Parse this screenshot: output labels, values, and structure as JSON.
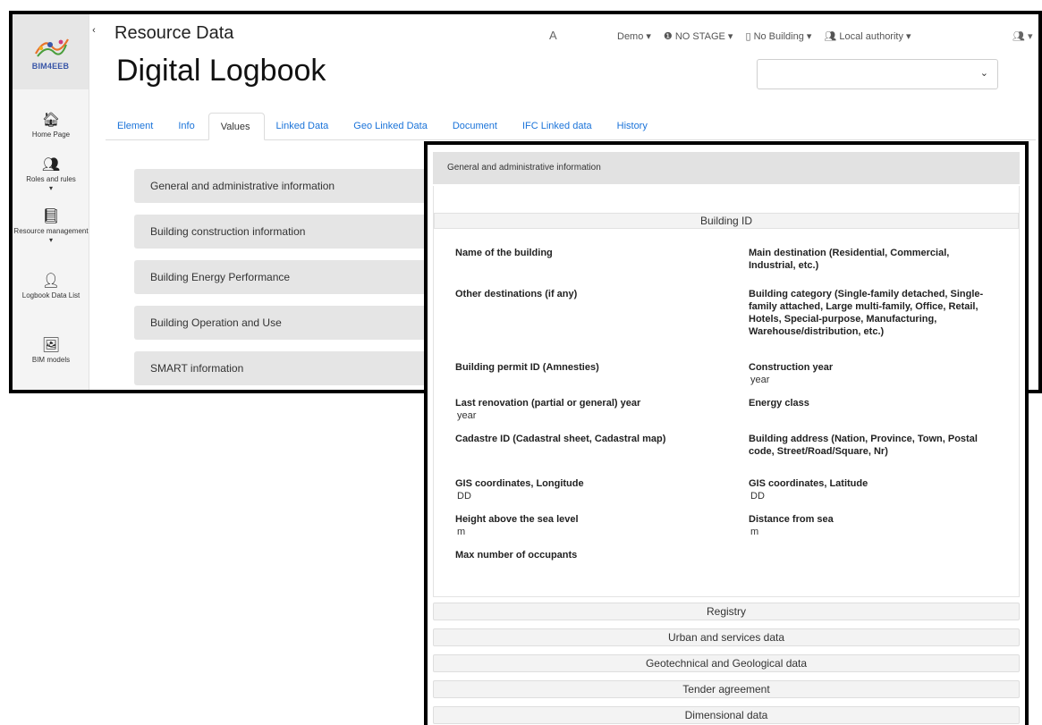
{
  "sidebar": {
    "logo_text": "BIM4EEB",
    "collapse_glyph": "‹",
    "items": [
      {
        "icon": "home-icon",
        "glyph": "🏠︎",
        "label": "Home Page"
      },
      {
        "icon": "users-icon",
        "glyph": "👥︎",
        "label": "Roles and rules",
        "caret": "▾"
      },
      {
        "icon": "book-icon",
        "glyph": "📘︎",
        "label": "Resource management",
        "caret": "▾"
      },
      {
        "icon": "logbook-icon",
        "glyph": "👤︎",
        "label": "Logbook Data List"
      },
      {
        "icon": "image-icon",
        "glyph": "🖼︎",
        "label": "BIM models"
      }
    ]
  },
  "header": {
    "subtitle": "Resource Data",
    "title": "Digital Logbook",
    "translate_glyph": "A",
    "project": "Demo ▾",
    "stage": "❶ NO STAGE ▾",
    "building": "▯ No Building ▾",
    "role": "👥︎ Local authority ▾",
    "user": "👥︎ ▾",
    "select_value": "",
    "select_arrow": "⌄"
  },
  "tabs": [
    {
      "label": "Element",
      "active": false
    },
    {
      "label": "Info",
      "active": false
    },
    {
      "label": "Values",
      "active": true
    },
    {
      "label": "Linked Data",
      "active": false
    },
    {
      "label": "Geo Linked Data",
      "active": false
    },
    {
      "label": "Document",
      "active": false
    },
    {
      "label": "IFC Linked data",
      "active": false
    },
    {
      "label": "History",
      "active": false
    }
  ],
  "accordion": [
    "General and administrative information",
    "Building construction information",
    "Building Energy Performance",
    "Building Operation and Use",
    "SMART information"
  ],
  "overlay": {
    "header": "General and administrative information",
    "section_title": "Building ID",
    "fields": [
      {
        "label": "Name of the building",
        "unit": ""
      },
      {
        "label": "Main destination (Residential, Commercial, Industrial, etc.)",
        "unit": ""
      },
      {
        "label": "Other destinations (if any)",
        "unit": ""
      },
      {
        "label": "Building category (Single-family detached, Single-family attached, Large multi-family, Office, Retail, Hotels, Special-purpose, Manufacturing, Warehouse/distribution, etc.)",
        "unit": ""
      },
      {
        "label": "Building permit ID (Amnesties)",
        "unit": ""
      },
      {
        "label": "Construction year",
        "unit": "year"
      },
      {
        "label": "Last renovation (partial or general) year",
        "unit": "year"
      },
      {
        "label": "Energy class",
        "unit": ""
      },
      {
        "label": "Cadastre ID (Cadastral sheet, Cadastral map)",
        "unit": ""
      },
      {
        "label": "Building address (Nation, Province, Town, Postal code, Street/Road/Square, Nr)",
        "unit": ""
      },
      {
        "label": "GIS coordinates, Longitude",
        "unit": "DD"
      },
      {
        "label": "GIS coordinates, Latitude",
        "unit": "DD"
      },
      {
        "label": "Height above the sea level",
        "unit": "m"
      },
      {
        "label": "Distance from sea",
        "unit": "m"
      },
      {
        "label": "Max number of occupants",
        "unit": ""
      }
    ],
    "sections": [
      "Registry",
      "Urban and services data",
      "Geotechnical and Geological data",
      "Tender agreement",
      "Dimensional data"
    ]
  }
}
